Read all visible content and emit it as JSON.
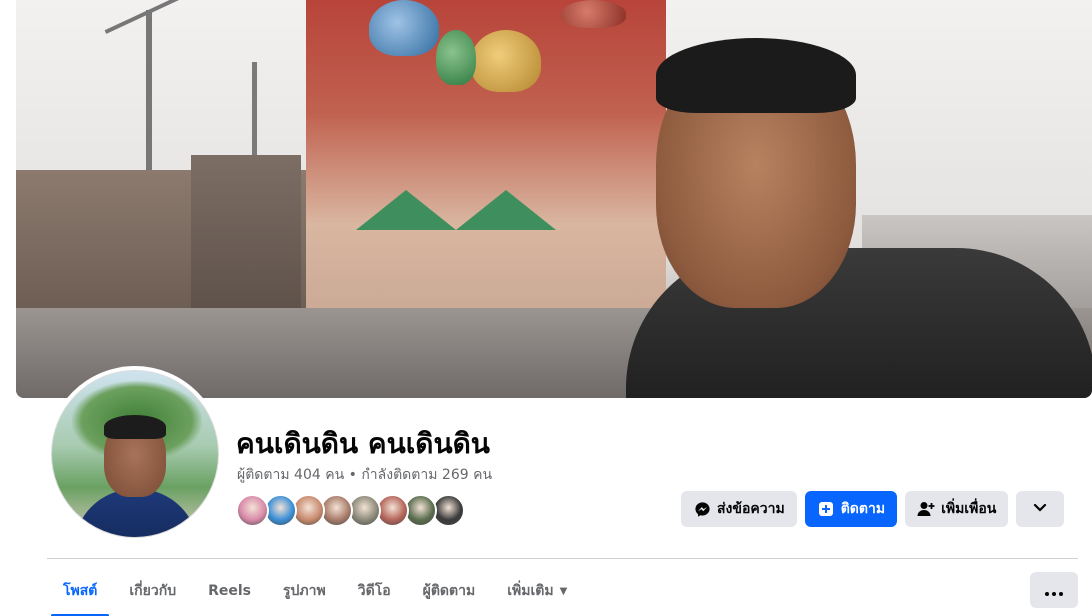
{
  "profile": {
    "name": "คนเดินดิน คนเดินดิน",
    "followers_label": "ผู้ติดตาม",
    "followers_count": "404",
    "followers_unit": "คน",
    "separator": "•",
    "following_label": "กำลังติดตาม",
    "following_count": "269",
    "following_unit": "คน"
  },
  "friend_avatars": [
    {
      "color": "#d88aa8"
    },
    {
      "color": "#3a8fd6"
    },
    {
      "color": "#c98a6d"
    },
    {
      "color": "#a97c6a"
    },
    {
      "color": "#8c8a7a"
    },
    {
      "color": "#b5655a"
    },
    {
      "color": "#5b6e4f"
    },
    {
      "color": "#3b3b3b"
    }
  ],
  "actions": {
    "message_label": "ส่งข้อความ",
    "follow_label": "ติดตาม",
    "add_friend_label": "เพิ่มเพื่อน"
  },
  "tabs": [
    {
      "label": "โพสต์",
      "active": true
    },
    {
      "label": "เกี่ยวกับ",
      "active": false
    },
    {
      "label": "Reels",
      "active": false
    },
    {
      "label": "รูปภาพ",
      "active": false
    },
    {
      "label": "วิดีโอ",
      "active": false
    },
    {
      "label": "ผู้ติดตาม",
      "active": false
    },
    {
      "label": "เพิ่มเติม",
      "active": false
    }
  ],
  "colors": {
    "accent": "#0866ff",
    "button_grey": "#e4e6eb",
    "secondary_text": "#65676b"
  }
}
